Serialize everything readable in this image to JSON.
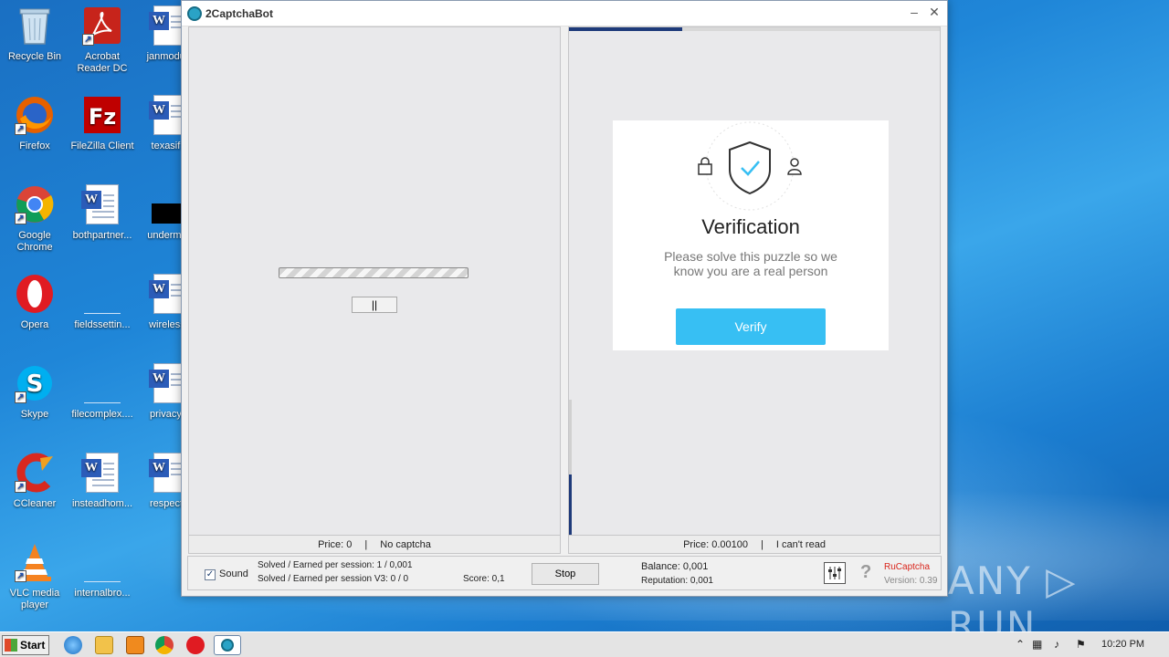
{
  "desktop": {
    "icons": [
      {
        "label": "Recycle Bin"
      },
      {
        "label": "Acrobat Reader DC"
      },
      {
        "label": "janmodule"
      },
      {
        "label": "Firefox"
      },
      {
        "label": "FileZilla Client"
      },
      {
        "label": "texasif..."
      },
      {
        "label": "Google Chrome"
      },
      {
        "label": "bothpartner..."
      },
      {
        "label": "underman"
      },
      {
        "label": "Opera"
      },
      {
        "label": "fieldssettin..."
      },
      {
        "label": "wirelessn"
      },
      {
        "label": "Skype"
      },
      {
        "label": "filecomplex...."
      },
      {
        "label": "privacym"
      },
      {
        "label": "CCleaner"
      },
      {
        "label": "insteadhom..."
      },
      {
        "label": "respectiv"
      },
      {
        "label": "VLC media player"
      },
      {
        "label": "internalbro..."
      }
    ]
  },
  "window": {
    "title": "2CaptchaBot",
    "left_pane": {
      "price_label": "Price: 0",
      "separator": "|",
      "status": "No captcha",
      "pause_label": "||"
    },
    "right_pane": {
      "price_label": "Price: 0.00100",
      "separator": "|",
      "cant_read": "I can't read",
      "card": {
        "heading": "Verification",
        "message": "Please solve this puzzle so we know you are a real person",
        "verify_label": "Verify"
      }
    },
    "bottom": {
      "sound_label": "Sound",
      "sound_checked": true,
      "solved_session": "Solved / Earned per session: 1 / 0,001",
      "solved_session_v3": "Solved / Earned per session V3: 0 / 0",
      "score": "Score: 0,1",
      "stop_label": "Stop",
      "balance": "Balance:  0,001",
      "reputation": "Reputation: 0,001",
      "brand": "RuCaptcha",
      "version": "Version: 0.39"
    }
  },
  "watermark": "ANY ▷ RUN",
  "taskbar": {
    "start_label": "Start",
    "clock": "10:20 PM"
  },
  "colors": {
    "verify_button": "#37bff3",
    "brand_red": "#d9261c",
    "progress_accent": "#1e3a7a"
  }
}
